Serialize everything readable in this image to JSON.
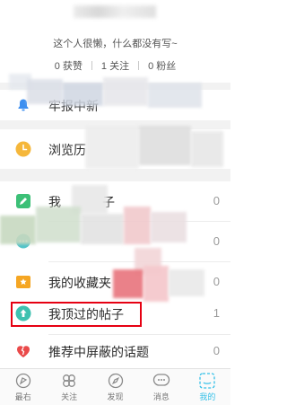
{
  "profile": {
    "bio": "这个人很懒，什么都没有写~",
    "stats": [
      {
        "value": "0",
        "label": "获赞"
      },
      {
        "value": "1",
        "label": "关注"
      },
      {
        "value": "0",
        "label": "粉丝"
      }
    ]
  },
  "menu": {
    "notifications": {
      "label": "牢报中新"
    },
    "history": {
      "label": "浏览历"
    },
    "my_posts": {
      "label": "我",
      "label_suffix": "子",
      "count": "0"
    },
    "my_replies": {
      "count": "0"
    },
    "favorites": {
      "label": "我的收藏夹",
      "count": "0"
    },
    "upvoted": {
      "label": "我顶过的帖子",
      "count": "1"
    },
    "hidden_topics": {
      "label": "推荐中屏蔽的话题",
      "count": "0"
    }
  },
  "tabbar": {
    "items": [
      {
        "label": "最右"
      },
      {
        "label": "关注"
      },
      {
        "label": "发现"
      },
      {
        "label": "消息"
      },
      {
        "label": "我的"
      }
    ]
  },
  "colors": {
    "accent": "#35c0e8",
    "highlight": "#e60012",
    "history_icon": "#f5b73b",
    "posts_icon": "#3cc077",
    "replies_icon": "#4fc3c8",
    "favorites_icon": "#f5a623",
    "upvoted_icon": "#3ec1b0",
    "hidden_icon": "#ea4a4a"
  }
}
